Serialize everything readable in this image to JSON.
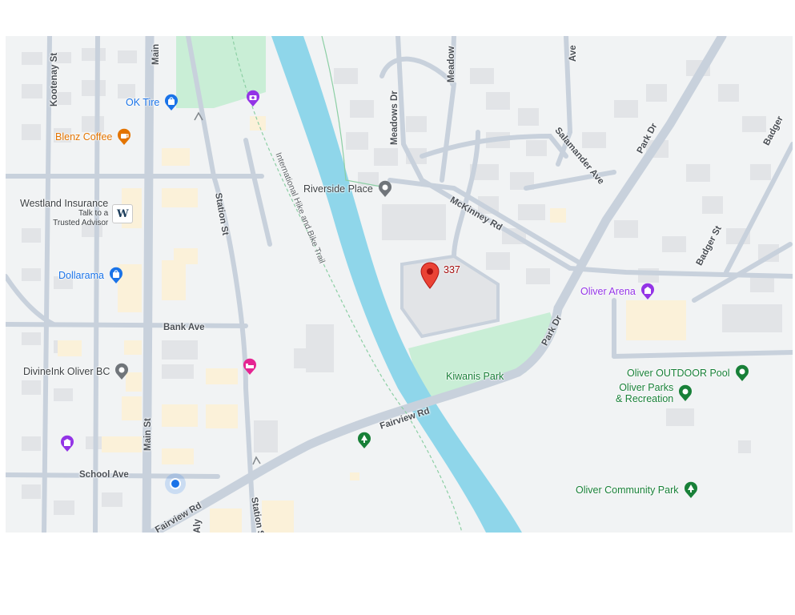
{
  "map": {
    "pois": {
      "ok_tire": "OK Tire",
      "blenz_coffee": "Blenz Coffee",
      "westland_insurance": "Westland Insurance",
      "westland_sub_line1": "Talk to a",
      "westland_sub_line2": "Trusted Advisor",
      "westland_logo": "W",
      "dollarama": "Dollarama",
      "divineink": "DivineInk Oliver BC",
      "riverside_place": "Riverside Place",
      "oliver_arena": "Oliver Arena",
      "kiwanis_park": "Kiwanis Park",
      "oliver_outdoor_pool": "Oliver OUTDOOR Pool",
      "oliver_parks_line1": "Oliver Parks",
      "oliver_parks_line2": "& Recreation",
      "oliver_community_park": "Oliver Community Park",
      "dropped_pin": "337"
    },
    "streets": {
      "kootenay_st": "Kootenay St",
      "main_st_top": "Main",
      "main_st": "Main St",
      "station_st": "Station St",
      "station_st_bottom": "Station S",
      "bank_ave": "Bank Ave",
      "school_ave": "School Ave",
      "fairview_rd": "Fairview Rd",
      "fairview_rd_bottom": "Fairview Rd",
      "aly": "Aly",
      "meadows_dr": "Meadows Dr",
      "meadow_top": "Meadow",
      "ave_top": "Ave",
      "salamander_ave": "Salamander Ave",
      "park_dr_top": "Park Dr",
      "park_dr": "Park Dr",
      "badger_st": "Badger St",
      "badger_top": "Badger",
      "mckinney_rd": "McKinney Rd",
      "trail": "International Hike and Bike Trail"
    },
    "icons": {
      "ok_tire": "shopping-bag-icon",
      "blenz_coffee": "coffee-cup-icon",
      "dollarama": "shopping-bag-icon",
      "divineink": "location-dot-icon",
      "riverside_place": "location-dot-icon",
      "oliver_arena": "arena-icon",
      "outdoor_pool": "park-dot-icon",
      "parks_recreation": "park-dot-icon",
      "community_park": "tree-icon",
      "fairview_park": "tree-icon",
      "camera_poi": "camera-icon",
      "hotel_poi": "bed-icon",
      "museum_poi": "museum-icon",
      "dropped_pin": "red-pin-icon",
      "current_location": "blue-location-dot"
    },
    "colors": {
      "river": "#8fd6ea",
      "park": "#c9eed6",
      "road": "#c8d1dc",
      "background": "#f1f3f4",
      "building": "#e2e4e7",
      "commercial": "#fbf1d9"
    }
  }
}
